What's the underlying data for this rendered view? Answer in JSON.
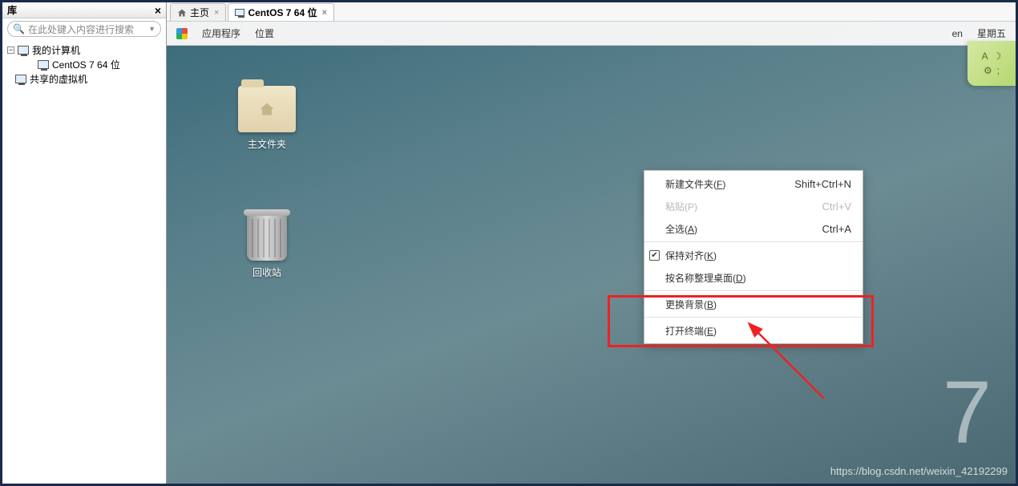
{
  "sidebar": {
    "title": "库",
    "search_placeholder": "在此处键入内容进行搜索",
    "tree": {
      "root": "我的计算机",
      "vm": "CentOS 7 64 位",
      "shared": "共享的虚拟机"
    }
  },
  "tabs": {
    "home": "主页",
    "vm": "CentOS 7 64 位"
  },
  "vm_top": {
    "apps": "应用程序",
    "places": "位置",
    "lang": "en",
    "day": "星期五"
  },
  "desktop": {
    "home_folder": "主文件夹",
    "trash": "回收站"
  },
  "context_menu": {
    "new_folder": {
      "label": "新建文件夹(",
      "key": "F",
      "tail": ")",
      "shortcut": "Shift+Ctrl+N"
    },
    "paste": {
      "label": "粘贴(P)",
      "shortcut": "Ctrl+V"
    },
    "select_all": {
      "label": "全选(",
      "key": "A",
      "tail": ")",
      "shortcut": "Ctrl+A"
    },
    "keep_aligned": {
      "label": "保持对齐(",
      "key": "K",
      "tail": ")"
    },
    "organize": {
      "label": "按名称整理桌面(",
      "key": "D",
      "tail": ")"
    },
    "change_bg": {
      "label": "更换背景(",
      "key": "B",
      "tail": ")"
    },
    "open_terminal": {
      "label": "打开终端(",
      "key": "E",
      "tail": ")"
    }
  },
  "big_seven": "7",
  "watermark": "https://blog.csdn.net/weixin_42192299",
  "notify": {
    "a": "A",
    "gear": "⚙",
    "dots": ";"
  }
}
